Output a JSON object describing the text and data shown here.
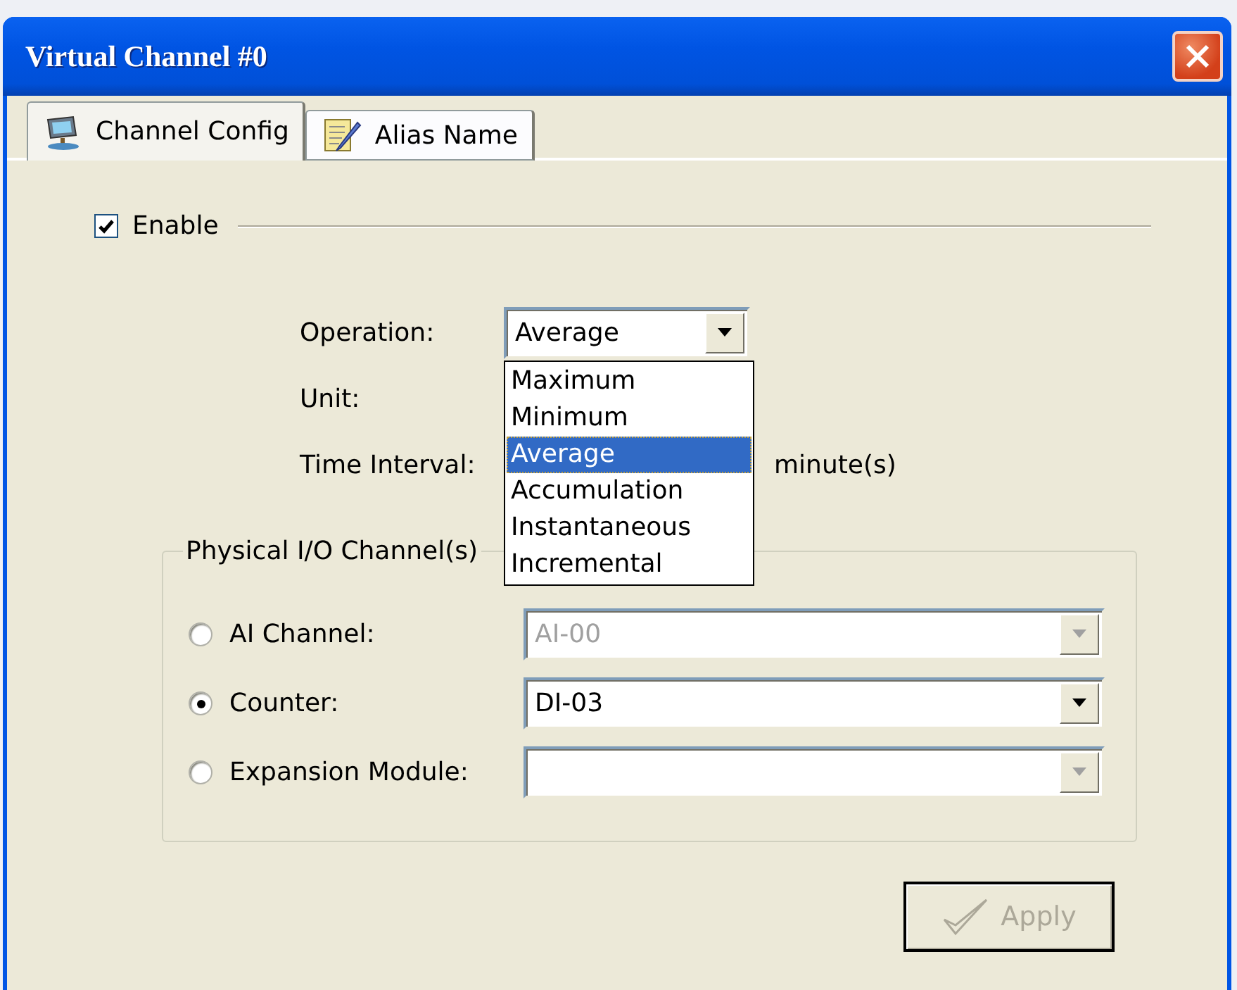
{
  "window": {
    "title": "Virtual Channel #0"
  },
  "tabs": [
    {
      "label": "Channel Config",
      "selected": true
    },
    {
      "label": "Alias Name",
      "selected": false
    }
  ],
  "enable": {
    "label": "Enable",
    "checked": true
  },
  "operation": {
    "label": "Operation:",
    "value": "Average",
    "expanded": true,
    "options": [
      {
        "label": "Maximum",
        "selected": false
      },
      {
        "label": "Minimum",
        "selected": false
      },
      {
        "label": "Average",
        "selected": true
      },
      {
        "label": "Accumulation",
        "selected": false
      },
      {
        "label": "Instantaneous",
        "selected": false
      },
      {
        "label": "Incremental",
        "selected": false
      }
    ]
  },
  "unit": {
    "label": "Unit:"
  },
  "time_interval": {
    "label": "Time Interval:",
    "suffix": "minute(s)"
  },
  "physical_io": {
    "title": "Physical I/O Channel(s)",
    "channels": [
      {
        "label": "AI Channel:",
        "selected": false,
        "value": "AI-00",
        "disabled": true
      },
      {
        "label": "Counter:",
        "selected": true,
        "value": "DI-03",
        "disabled": false
      },
      {
        "label": "Expansion Module:",
        "selected": false,
        "disabled": true
      }
    ]
  },
  "apply_button": {
    "label": "Apply",
    "disabled": true
  }
}
